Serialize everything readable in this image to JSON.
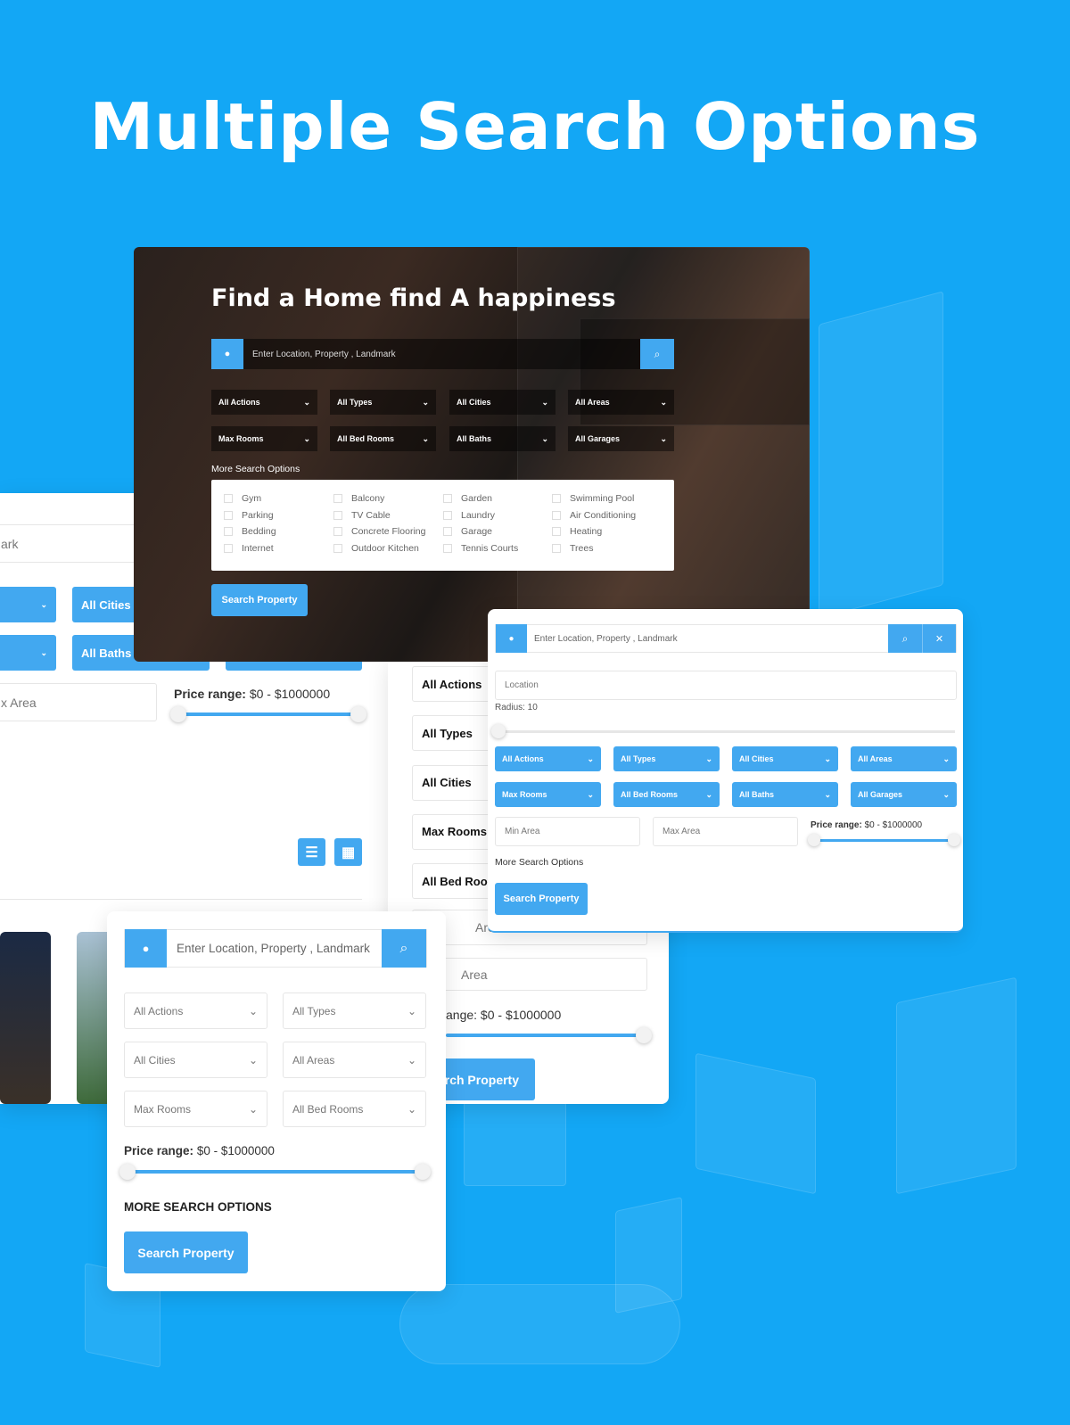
{
  "headline": "Multiple Search Options",
  "colors": {
    "background": "#13a7f5",
    "accent": "#42a8f0"
  },
  "panel_left": {
    "location_partial": "ark",
    "dropdowns_row1": [
      "",
      "All Cities"
    ],
    "dropdowns_row2": [
      "",
      "All Baths"
    ],
    "max_area_partial": "x Area",
    "price_range_label": "Price range:",
    "price_range_value": "$0 - $1000000",
    "price_min_pct": 0,
    "price_max_pct": 100,
    "view_icons": [
      "list-view-icon",
      "grid-view-icon"
    ]
  },
  "panel_middle": {
    "fields": [
      "All Actions",
      "All Types",
      "All Cities",
      "Max Rooms",
      "All Bed Rooms"
    ],
    "min_area_partial": "Area",
    "max_area_partial": "Area",
    "price_range_partial": "ange: $0 - $1000000",
    "search_partial": "rch Property"
  },
  "hero": {
    "title": "Find a Home find A happiness",
    "search_placeholder": "Enter Location, Property , Landmark",
    "dropdowns": [
      "All Actions",
      "All Types",
      "All Cities",
      "All Areas",
      "Max Rooms",
      "All Bed Rooms",
      "All Baths",
      "All Garages"
    ],
    "more_options_label": "More Search Options",
    "amenities": [
      "Gym",
      "Balcony",
      "Garden",
      "Swimming Pool",
      "Parking",
      "TV Cable",
      "Laundry",
      "Air Conditioning",
      "Bedding",
      "Concrete Flooring",
      "Garage",
      "Heating",
      "Internet",
      "Outdoor Kitchen",
      "Tennis Courts",
      "Trees"
    ],
    "search_button": "Search Property"
  },
  "panel_right": {
    "search_placeholder": "Enter Location, Property , Landmark",
    "location_placeholder": "Location",
    "radius_label": "Radius: 10",
    "radius_pct": 0,
    "dropdowns": [
      "All Actions",
      "All Types",
      "All Cities",
      "All Areas",
      "Max Rooms",
      "All Bed Rooms",
      "All Baths",
      "All Garages"
    ],
    "min_area_placeholder": "Min Area",
    "max_area_placeholder": "Max Area",
    "price_range_label": "Price range:",
    "price_range_value": "$0 - $1000000",
    "more_options_label": "More Search Options",
    "search_button": "Search Property"
  },
  "panel_bottom": {
    "search_placeholder": "Enter Location, Property , Landmark",
    "dropdowns": [
      "All Actions",
      "All Types",
      "All Cities",
      "All Areas",
      "Max Rooms",
      "All Bed Rooms"
    ],
    "price_range_label": "Price range:",
    "price_range_value": "$0 - $1000000",
    "more_options_label": "MORE SEARCH OPTIONS",
    "search_button": "Search Property"
  }
}
